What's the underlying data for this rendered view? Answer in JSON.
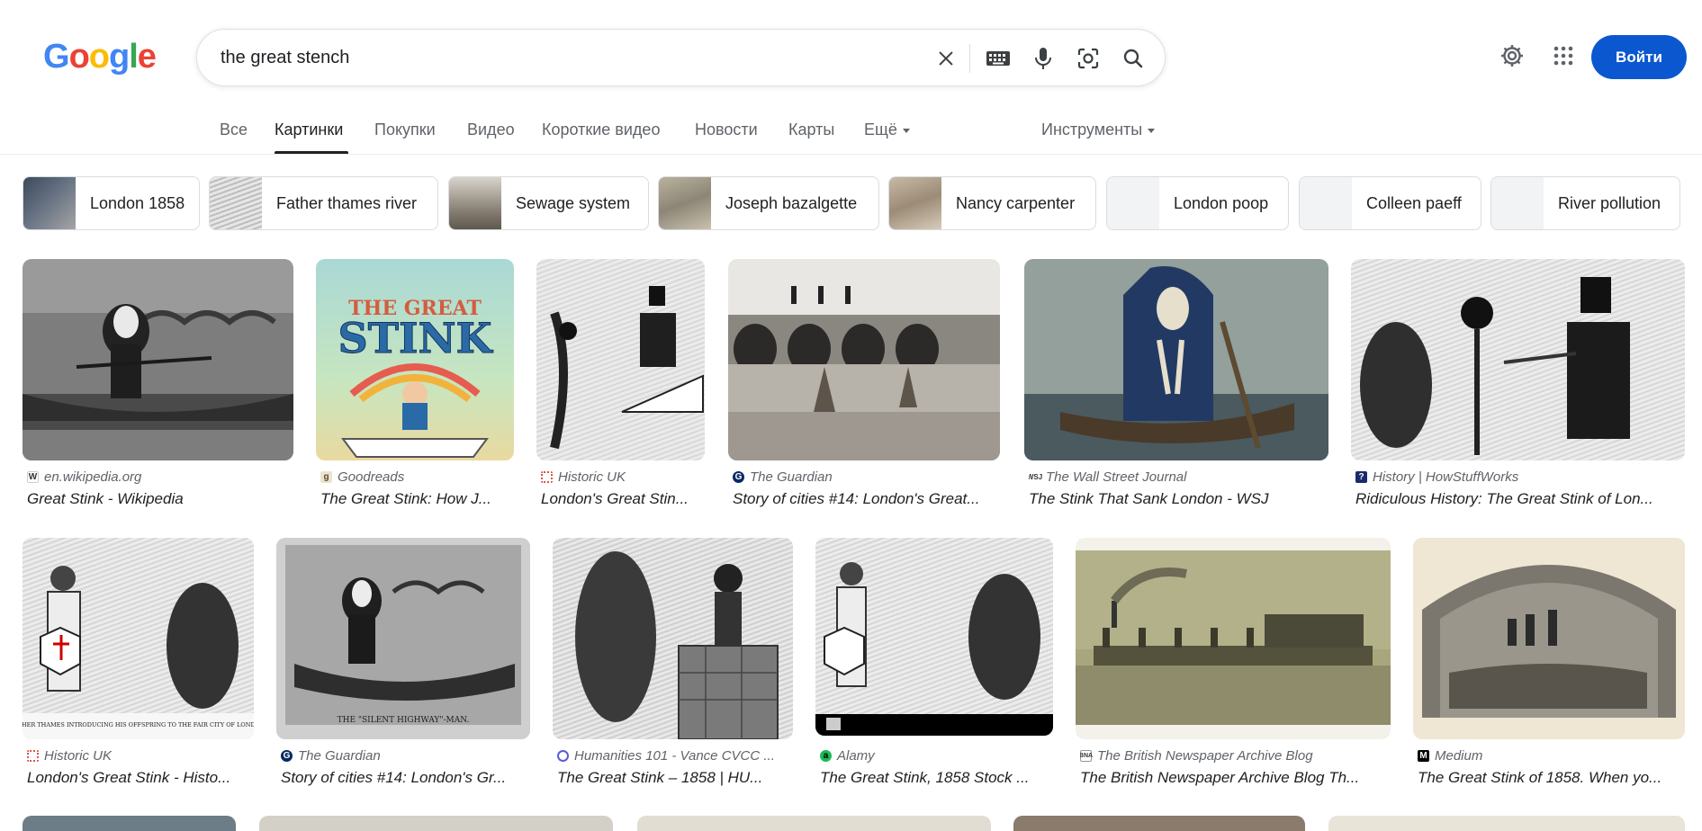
{
  "search": {
    "query": "the great stench"
  },
  "header": {
    "logo": "Google",
    "signin_label": "Войти"
  },
  "icons": {
    "clear": "close-icon",
    "keyboard": "keyboard-icon",
    "voice": "mic-icon",
    "lens": "camera-lens-icon",
    "search": "search-icon",
    "settings": "gear-icon",
    "apps": "apps-grid-icon"
  },
  "tabs": [
    {
      "label": "Все"
    },
    {
      "label": "Картинки"
    },
    {
      "label": "Покупки"
    },
    {
      "label": "Видео"
    },
    {
      "label": "Короткие видео"
    },
    {
      "label": "Новости"
    },
    {
      "label": "Карты"
    },
    {
      "label": "Ещё"
    }
  ],
  "tools_label": "Инструменты",
  "chips": [
    {
      "label": "London 1858"
    },
    {
      "label": "Father thames river"
    },
    {
      "label": "Sewage system"
    },
    {
      "label": "Joseph bazalgette"
    },
    {
      "label": "Nancy carpenter"
    },
    {
      "label": "London poop"
    },
    {
      "label": "Colleen paeff"
    },
    {
      "label": "River pollution"
    }
  ],
  "results": [
    {
      "source": "en.wikipedia.org",
      "title": "Great Stink - Wikipedia"
    },
    {
      "source": "Goodreads",
      "title": "The Great Stink: How J..."
    },
    {
      "source": "Historic UK",
      "title": "London's Great Stin..."
    },
    {
      "source": "The Guardian",
      "title": "Story of cities #14: London's Great..."
    },
    {
      "source": "The Wall Street Journal",
      "title": "The Stink That Sank London - WSJ"
    },
    {
      "source": "History | HowStuffWorks",
      "title": "Ridiculous History: The Great Stink of Lon..."
    },
    {
      "source": "Historic UK",
      "title": "London's Great Stink - Histo..."
    },
    {
      "source": "The Guardian",
      "title": "Story of cities #14: London's Gr..."
    },
    {
      "source": "Humanities 101 - Vance CVCC ...",
      "title": "The Great Stink – 1858 | HU..."
    },
    {
      "source": "Alamy",
      "title": "The Great Stink, 1858 Stock ..."
    },
    {
      "source": "The British Newspaper Archive Blog",
      "title": "The British Newspaper Archive Blog Th..."
    },
    {
      "source": "Medium",
      "title": "The Great Stink of 1858. When yo..."
    }
  ],
  "image_text": {
    "book_title_line1": "THE GREAT",
    "book_title_line2": "STINK",
    "caption_father_thames": "FATHER THAMES INTRODUCING HIS OFFSPRING TO THE FAIR CITY OF LONDON",
    "caption_silent_highway": "THE \"SILENT HIGHWAY\"-MAN."
  }
}
